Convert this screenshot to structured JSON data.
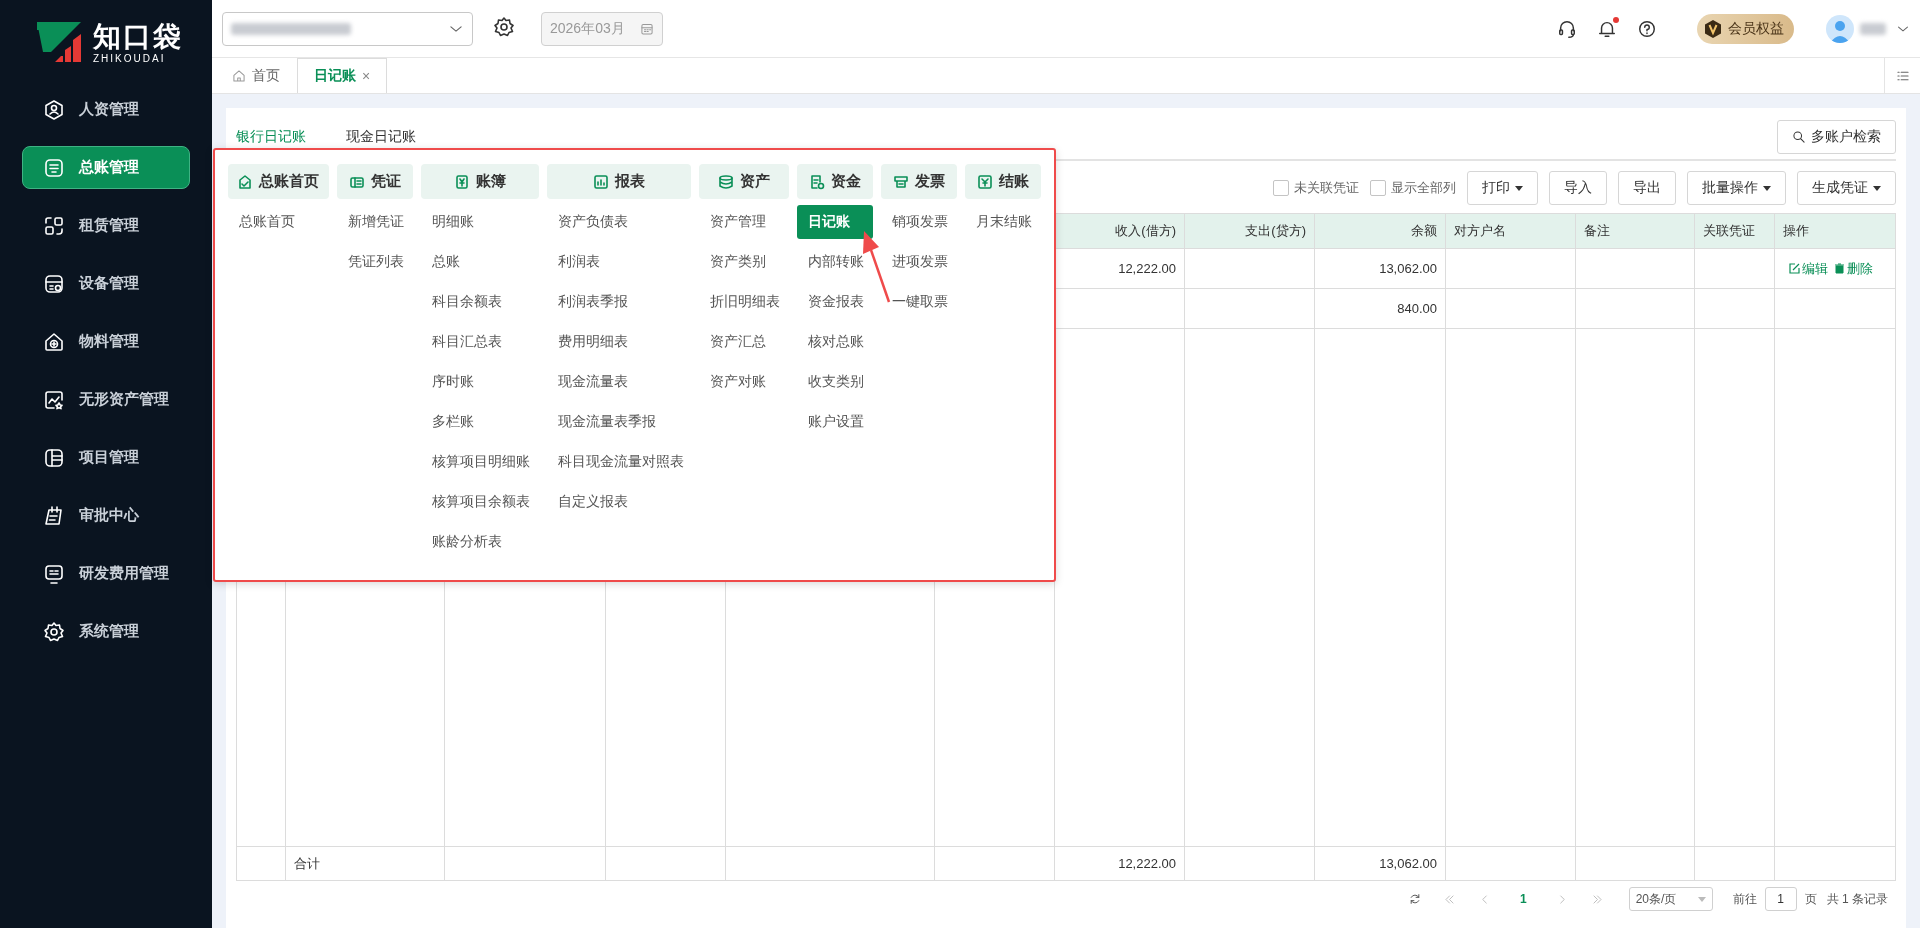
{
  "sidebar": {
    "logo": {
      "name": "知口袋",
      "subtitle": "ZHIKOUDAI"
    },
    "items": [
      {
        "label": "人资管理",
        "selected": false
      },
      {
        "label": "总账管理",
        "selected": true
      },
      {
        "label": "租赁管理",
        "selected": false
      },
      {
        "label": "设备管理",
        "selected": false
      },
      {
        "label": "物料管理",
        "selected": false
      },
      {
        "label": "无形资产管理",
        "selected": false
      },
      {
        "label": "项目管理",
        "selected": false
      },
      {
        "label": "审批中心",
        "selected": false
      },
      {
        "label": "研发费用管理",
        "selected": false
      },
      {
        "label": "系统管理",
        "selected": false
      }
    ]
  },
  "topbar": {
    "period": "2026年03月",
    "membership": "会员权益",
    "notification": true
  },
  "tabs": [
    {
      "label": "首页",
      "kind": "home",
      "selected": false
    },
    {
      "label": "日记账",
      "kind": "page",
      "selected": true,
      "close": "×"
    }
  ],
  "subtabs": [
    {
      "label": "银行日记账",
      "selected": true
    },
    {
      "label": "现金日记账",
      "selected": false
    }
  ],
  "search_button": "多账户检索",
  "filters": [
    {
      "label": "未关联凭证",
      "checked": false
    },
    {
      "label": "显示全部列",
      "checked": false
    }
  ],
  "toolbar": [
    {
      "label": "打印",
      "dropdown": true
    },
    {
      "label": "导入",
      "dropdown": false
    },
    {
      "label": "导出",
      "dropdown": false
    },
    {
      "label": "批量操作",
      "dropdown": true
    },
    {
      "label": "生成凭证",
      "dropdown": true
    }
  ],
  "table": {
    "columns": [
      {
        "label": "收入(借方)"
      },
      {
        "label": "支出(贷方)"
      },
      {
        "label": "余额"
      },
      {
        "label": "对方户名"
      },
      {
        "label": "备注"
      },
      {
        "label": "关联凭证"
      },
      {
        "label": "操作"
      }
    ],
    "rows": [
      {
        "cells": [
          "12,222.00",
          null,
          "13,062.00",
          null,
          null,
          null
        ],
        "actions": [
          {
            "label": "编辑",
            "kind": "edit"
          },
          {
            "label": "删除",
            "kind": "delete"
          }
        ]
      },
      {
        "cells": [
          null,
          null,
          "840.00",
          null,
          null,
          null
        ],
        "actions": []
      }
    ],
    "total": {
      "label": "合计",
      "cells": [
        "12,222.00",
        null,
        "13,062.00",
        null,
        null,
        null,
        null
      ]
    }
  },
  "pagination": {
    "pages": [
      {
        "label": "1",
        "selected": true
      }
    ],
    "page_size": "20条/页",
    "goto_label": "前往",
    "goto_value": "1",
    "page_unit": "页",
    "total": "共 1 条记录"
  },
  "menu": {
    "columns": [
      {
        "title": "总账首页",
        "items": [
          {
            "label": "总账首页",
            "selected": false
          }
        ]
      },
      {
        "title": "凭证",
        "items": [
          {
            "label": "新增凭证",
            "selected": false
          },
          {
            "label": "凭证列表",
            "selected": false
          }
        ]
      },
      {
        "title": "账簿",
        "items": [
          {
            "label": "明细账",
            "selected": false
          },
          {
            "label": "总账",
            "selected": false
          },
          {
            "label": "科目余额表",
            "selected": false
          },
          {
            "label": "科目汇总表",
            "selected": false
          },
          {
            "label": "序时账",
            "selected": false
          },
          {
            "label": "多栏账",
            "selected": false
          },
          {
            "label": "核算项目明细账",
            "selected": false
          },
          {
            "label": "核算项目余额表",
            "selected": false
          },
          {
            "label": "账龄分析表",
            "selected": false
          }
        ]
      },
      {
        "title": "报表",
        "items": [
          {
            "label": "资产负债表",
            "selected": false
          },
          {
            "label": "利润表",
            "selected": false
          },
          {
            "label": "利润表季报",
            "selected": false
          },
          {
            "label": "费用明细表",
            "selected": false
          },
          {
            "label": "现金流量表",
            "selected": false
          },
          {
            "label": "现金流量表季报",
            "selected": false
          },
          {
            "label": "科目现金流量对照表",
            "selected": false
          },
          {
            "label": "自定义报表",
            "selected": false
          }
        ]
      },
      {
        "title": "资产",
        "items": [
          {
            "label": "资产管理",
            "selected": false
          },
          {
            "label": "资产类别",
            "selected": false
          },
          {
            "label": "折旧明细表",
            "selected": false
          },
          {
            "label": "资产汇总",
            "selected": false
          },
          {
            "label": "资产对账",
            "selected": false
          }
        ]
      },
      {
        "title": "资金",
        "items": [
          {
            "label": "日记账",
            "selected": true
          },
          {
            "label": "内部转账",
            "selected": false
          },
          {
            "label": "资金报表",
            "selected": false
          },
          {
            "label": "核对总账",
            "selected": false
          },
          {
            "label": "收支类别",
            "selected": false
          },
          {
            "label": "账户设置",
            "selected": false
          }
        ]
      },
      {
        "title": "发票",
        "items": [
          {
            "label": "销项发票",
            "selected": false
          },
          {
            "label": "进项发票",
            "selected": false
          },
          {
            "label": "一键取票",
            "selected": false
          }
        ]
      },
      {
        "title": "结账",
        "items": [
          {
            "label": "月末结账",
            "selected": false
          }
        ]
      }
    ]
  }
}
